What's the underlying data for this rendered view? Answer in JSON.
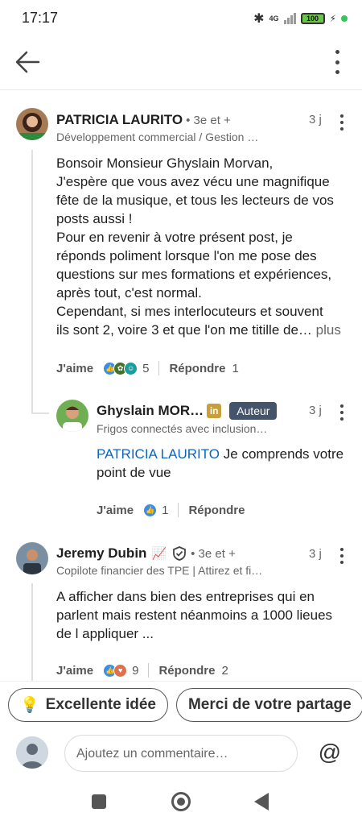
{
  "status": {
    "time": "17:17",
    "network": "4G",
    "battery": "100"
  },
  "header": {
    "back_label": "Retour",
    "more_label": "Plus"
  },
  "comments": [
    {
      "author": "PATRICIA LAURITO",
      "degree": "• 3e et +",
      "headline": "Développement commercial / Gestion …",
      "time": "3 j",
      "text_lines": [
        "Bonsoir Monsieur Ghyslain Morvan,",
        "J'espère que vous avez vécu une magnifique",
        "fête de la musique, et tous les lecteurs de vos",
        "posts aussi !",
        "Pour en revenir à votre présent post, je",
        "réponds poliment lorsque l'on me pose des",
        "questions sur mes formations et expériences,",
        "après tout, c'est normal.",
        "Cependant, si mes interlocuteurs et souvent",
        "ils sont 2, voire 3 et que l'on me titille de…"
      ],
      "more": "plus",
      "like_label": "J'aime",
      "reaction_count": "5",
      "reply_label": "Répondre",
      "reply_count": "1"
    },
    {
      "author": "Ghyslain MOR…",
      "badge": "Auteur",
      "headline": "Frigos connectés avec inclusion…",
      "time": "3 j",
      "mention": "PATRICIA LAURITO",
      "text_first": " Je comprends votre",
      "text_second": "point de vue",
      "like_label": "J'aime",
      "reaction_count": "1",
      "reply_label": "Répondre"
    },
    {
      "author": "Jeremy Dubin",
      "degree": "• 3e et +",
      "headline": "Copilote financier des TPE | Attirez et fi…",
      "time": "3 j",
      "text_lines": [
        "A afficher dans bien des entreprises qui en",
        "parlent mais restent néanmoins a 1000 lieues",
        "de l appliquer ..."
      ],
      "like_label": "J'aime",
      "reaction_count": "9",
      "reply_label": "Répondre",
      "reply_count": "2"
    }
  ],
  "chips": [
    "Excellente idée",
    "Merci de votre partage"
  ],
  "composer": {
    "placeholder": "Ajoutez un commentaire…"
  },
  "colors": {
    "mention": "#0a66c2",
    "author_badge": "#44546a",
    "like_blue": "#378fe9"
  }
}
